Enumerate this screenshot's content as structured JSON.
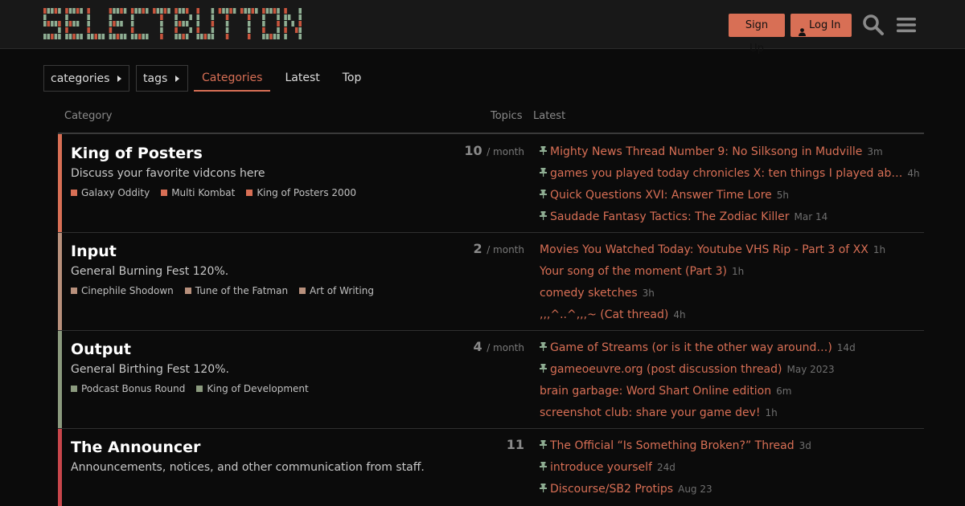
{
  "header": {
    "logo_text": "SELECTBUTTON",
    "signup_label": "Sign Up",
    "login_label": "Log In",
    "colors": {
      "accent": "#d86f55",
      "logo_green": "#8fae93",
      "logo_red": "#c8553d"
    }
  },
  "nav": {
    "categories_dropdown": "categories",
    "tags_dropdown": "tags",
    "tabs": [
      {
        "label": "Categories",
        "active": true
      },
      {
        "label": "Latest",
        "active": false
      },
      {
        "label": "Top",
        "active": false
      }
    ]
  },
  "table": {
    "col_category": "Category",
    "col_topics": "Topics",
    "col_latest": "Latest"
  },
  "categories": [
    {
      "name": "King of Posters",
      "description": "Discuss your favorite vidcons here",
      "color": "#d86f55",
      "count": "10",
      "per": "/ month",
      "subcategories": [
        {
          "name": "Galaxy Oddity",
          "color": "#d86f55"
        },
        {
          "name": "Multi Kombat",
          "color": "#d86f55"
        },
        {
          "name": "King of Posters 2000",
          "color": "#d86f55"
        }
      ],
      "topics": [
        {
          "title": "Mighty News Thread Number 9: No Silksong in Mudville",
          "age": "3m",
          "pinned": true
        },
        {
          "title": "games you played today chronicles X: ten things I played ab…",
          "age": "4h",
          "pinned": true
        },
        {
          "title": "Quick Questions XVI: Answer Time Lore",
          "age": "5h",
          "pinned": true
        },
        {
          "title": "Saudade Fantasy Tactics: The Zodiac Killer",
          "age": "Mar 14",
          "pinned": true
        }
      ]
    },
    {
      "name": "Input",
      "description": "General Burning Fest 120%.",
      "color": "#b8907c",
      "count": "2",
      "per": "/ month",
      "subcategories": [
        {
          "name": "Cinephile Shodown",
          "color": "#b8907c"
        },
        {
          "name": "Tune of the Fatman",
          "color": "#b8907c"
        },
        {
          "name": "Art of Writing",
          "color": "#b8907c"
        }
      ],
      "topics": [
        {
          "title": "Movies You Watched Today: Youtube VHS Rip - Part 3 of XX",
          "age": "1h",
          "pinned": false
        },
        {
          "title": "Your song of the moment (Part 3)",
          "age": "1h",
          "pinned": false
        },
        {
          "title": "comedy sketches",
          "age": "3h",
          "pinned": false
        },
        {
          "title": ",,,^..^,,,~ (Cat thread)",
          "age": "4h",
          "pinned": false
        }
      ]
    },
    {
      "name": "Output",
      "description": "General Birthing Fest 120%.",
      "color": "#8b9a7e",
      "count": "4",
      "per": "/ month",
      "subcategories": [
        {
          "name": "Podcast Bonus Round",
          "color": "#8b9a7e"
        },
        {
          "name": "King of Development",
          "color": "#8b9a7e"
        }
      ],
      "topics": [
        {
          "title": "Game of Streams (or is it the other way around…)",
          "age": "14d",
          "pinned": true
        },
        {
          "title": "gameoeuvre.org (post discussion thread)",
          "age": "May 2023",
          "pinned": true
        },
        {
          "title": "brain garbage: Word Shart Online edition",
          "age": "6m",
          "pinned": false
        },
        {
          "title": "screenshot club: share your game dev!",
          "age": "1h",
          "pinned": false
        }
      ]
    },
    {
      "name": "The Announcer",
      "description": "Announcements, notices, and other communication from staff.",
      "color": "#c8464b",
      "count": "11",
      "per": "",
      "subcategories": [],
      "topics": [
        {
          "title": "The Official “Is Something Broken?” Thread",
          "age": "3d",
          "pinned": true
        },
        {
          "title": "introduce yourself",
          "age": "24d",
          "pinned": true
        },
        {
          "title": "Discourse/SB2 Protips",
          "age": "Aug 23",
          "pinned": true
        }
      ]
    }
  ]
}
